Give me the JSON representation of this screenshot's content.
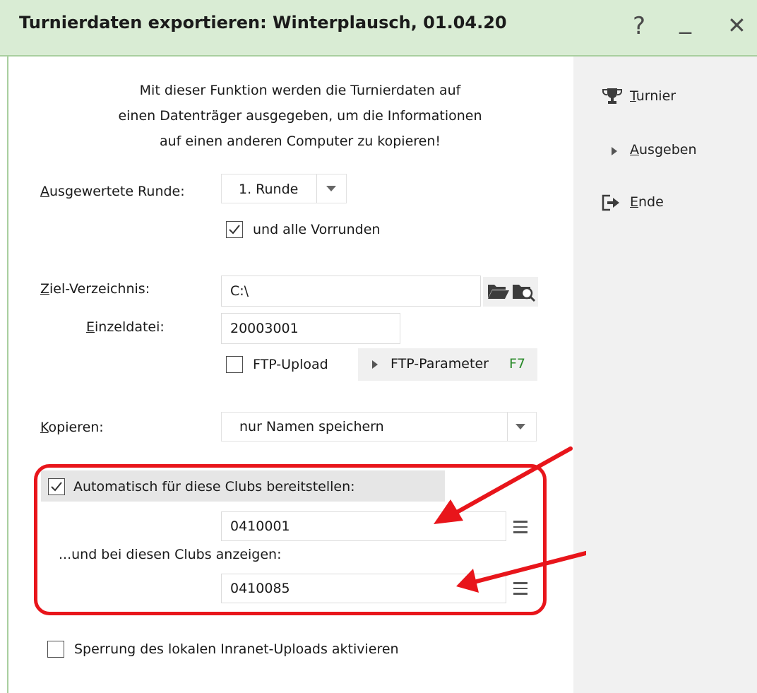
{
  "window": {
    "title": "Turnierdaten exportieren: Winterplausch, 01.04.20",
    "help": "?",
    "minimize": "_",
    "close": "✕"
  },
  "info_lines": [
    "Mit dieser Funktion werden die Turnierdaten auf",
    "einen Datenträger ausgegeben, um die Informationen",
    "auf einen anderen Computer zu kopieren!"
  ],
  "runde": {
    "label_u": "A",
    "label_rest": "usgewertete Runde:",
    "value": "1. Runde"
  },
  "vorrunden": {
    "label": "und alle Vorrunden",
    "checked": true
  },
  "ziel": {
    "label_u": "Z",
    "label_rest": "iel-Verzeichnis:",
    "value": "C:\\"
  },
  "einzel": {
    "label_u": "E",
    "label_rest": "inzeldatei:",
    "value": "20003001"
  },
  "ftp": {
    "label": "FTP-Upload",
    "checked": false,
    "param_label": "FTP-Parameter",
    "param_key": "F7"
  },
  "kopieren": {
    "label_u": "K",
    "label_rest": "opieren:",
    "value": "nur Namen speichern"
  },
  "auto_clubs": {
    "label": "Automatisch für diese Clubs bereitstellen:",
    "checked": true,
    "value": "0410001"
  },
  "show_clubs": {
    "label": "...und bei diesen Clubs anzeigen:",
    "value": "0410085"
  },
  "sperrung": {
    "label": "Sperrung des lokalen Inranet-Uploads aktivieren",
    "checked": false
  },
  "sidebar": [
    {
      "icon": "trophy-icon",
      "u": "T",
      "rest": "urnier"
    },
    {
      "icon": "triangle-right-icon",
      "u": "A",
      "rest": "usgeben"
    },
    {
      "icon": "exit-icon",
      "u": "E",
      "rest": "nde"
    }
  ],
  "colors": {
    "titlebar": "#d9ecd4",
    "highlight": "#e8151b",
    "accent_key": "#2a8a2a"
  }
}
